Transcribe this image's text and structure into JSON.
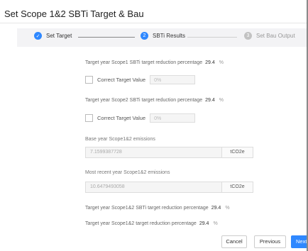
{
  "dialog": {
    "title": "Set Scope 1&2 SBTi Target & Bau"
  },
  "steps": [
    {
      "label": "Set Target",
      "marker": "✓",
      "state": "done"
    },
    {
      "label": "SBTi Results",
      "marker": "2",
      "state": "active"
    },
    {
      "label": "Set Bau Output",
      "marker": "3",
      "state": "pending"
    }
  ],
  "form": {
    "scope1_reduction": {
      "label": "Target year Scope1 SBTi target reduction percentage",
      "value": "29.4",
      "unit": "%"
    },
    "scope1_correct": {
      "label": "Correct Target Value",
      "placeholder": "0%"
    },
    "scope2_reduction": {
      "label": "Target year Scope2 SBTi target reduction percentage",
      "value": "29.4",
      "unit": "%"
    },
    "scope2_correct": {
      "label": "Correct Target Value",
      "placeholder": "0%"
    },
    "base_year": {
      "label": "Base year Scope1&2 emissions",
      "value": "7.1599387728",
      "unit": "tCO2e"
    },
    "recent_year": {
      "label": "Most recent year Scope1&2 emissions",
      "value": "10.6479493058",
      "unit": "tCO2e"
    },
    "scope12_sbti": {
      "label": "Target year Scope1&2 SBTi target reduction percentage",
      "value": "29.4",
      "unit": "%"
    },
    "scope12_target": {
      "label": "Target year Scope1&2 target reduction percentage",
      "value": "29.4",
      "unit": "%"
    }
  },
  "buttons": {
    "cancel": "Cancel",
    "previous": "Previous",
    "next": "Next"
  },
  "colors": {
    "accent": "#2f88ff",
    "pending": "#c2c2c2"
  }
}
